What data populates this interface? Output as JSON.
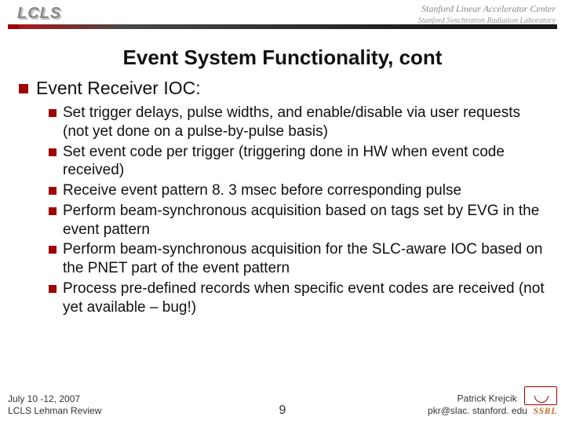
{
  "header": {
    "logo_text": "LCLS",
    "right_line1": "Stanford Linear Accelerator Center",
    "right_line2": "Stanford Synchrotron Radiation Laboratory"
  },
  "title": "Event System Functionality, cont",
  "lvl1_heading": "Event Receiver IOC:",
  "bullets": [
    "Set trigger delays, pulse widths, and enable/disable via user requests (not yet done on a pulse-by-pulse basis)",
    "Set event code per trigger (triggering done in HW when event code received)",
    "Receive event pattern 8. 3 msec before corresponding pulse",
    "Perform beam-synchronous acquisition based on tags set by EVG in the event pattern",
    "Perform beam-synchronous acquisition for the SLC-aware IOC based on the PNET part of the event pattern",
    "Process pre-defined records when specific event codes are received (not yet available – bug!)"
  ],
  "footer": {
    "date": "July 10 -12, 2007",
    "review": "LCLS Lehman Review",
    "page": "9",
    "author": "Patrick Krejcik",
    "email": "pkr@slac. stanford. edu",
    "ssrl": "SSRL"
  }
}
